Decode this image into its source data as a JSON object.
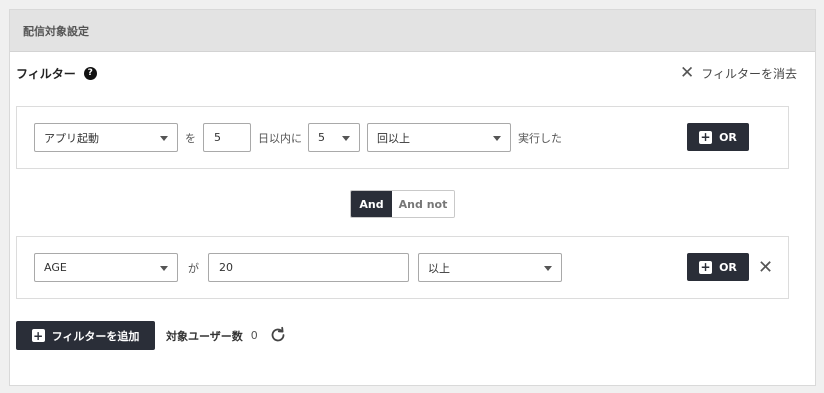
{
  "header": {
    "title": "配信対象設定"
  },
  "filter": {
    "label": "フィルター",
    "help_icon": "?",
    "clear_icon": "✕",
    "clear_label": "フィルターを消去"
  },
  "condition1": {
    "event_select": "アプリ起動",
    "particle": "を",
    "days_value": "5",
    "days_suffix": "日以内に",
    "count_select": "5",
    "compare_select": "回以上",
    "suffix": "実行した",
    "or_label": "OR",
    "or_icon": "+"
  },
  "logic_toggle": {
    "and": "And",
    "and_not": "And not",
    "selected": "And"
  },
  "condition2": {
    "attribute_select": "AGE",
    "particle": "が",
    "value": "20",
    "compare_select": "以上",
    "or_label": "OR",
    "or_icon": "+",
    "remove_icon": "✕"
  },
  "footer": {
    "add_filter_label": "フィルターを追加",
    "add_icon": "+",
    "target_users_label": "対象ユーザー数",
    "target_users_count": "0"
  },
  "colors": {
    "dark_button": "#2a2e38",
    "header_bg": "#e3e3e3"
  }
}
